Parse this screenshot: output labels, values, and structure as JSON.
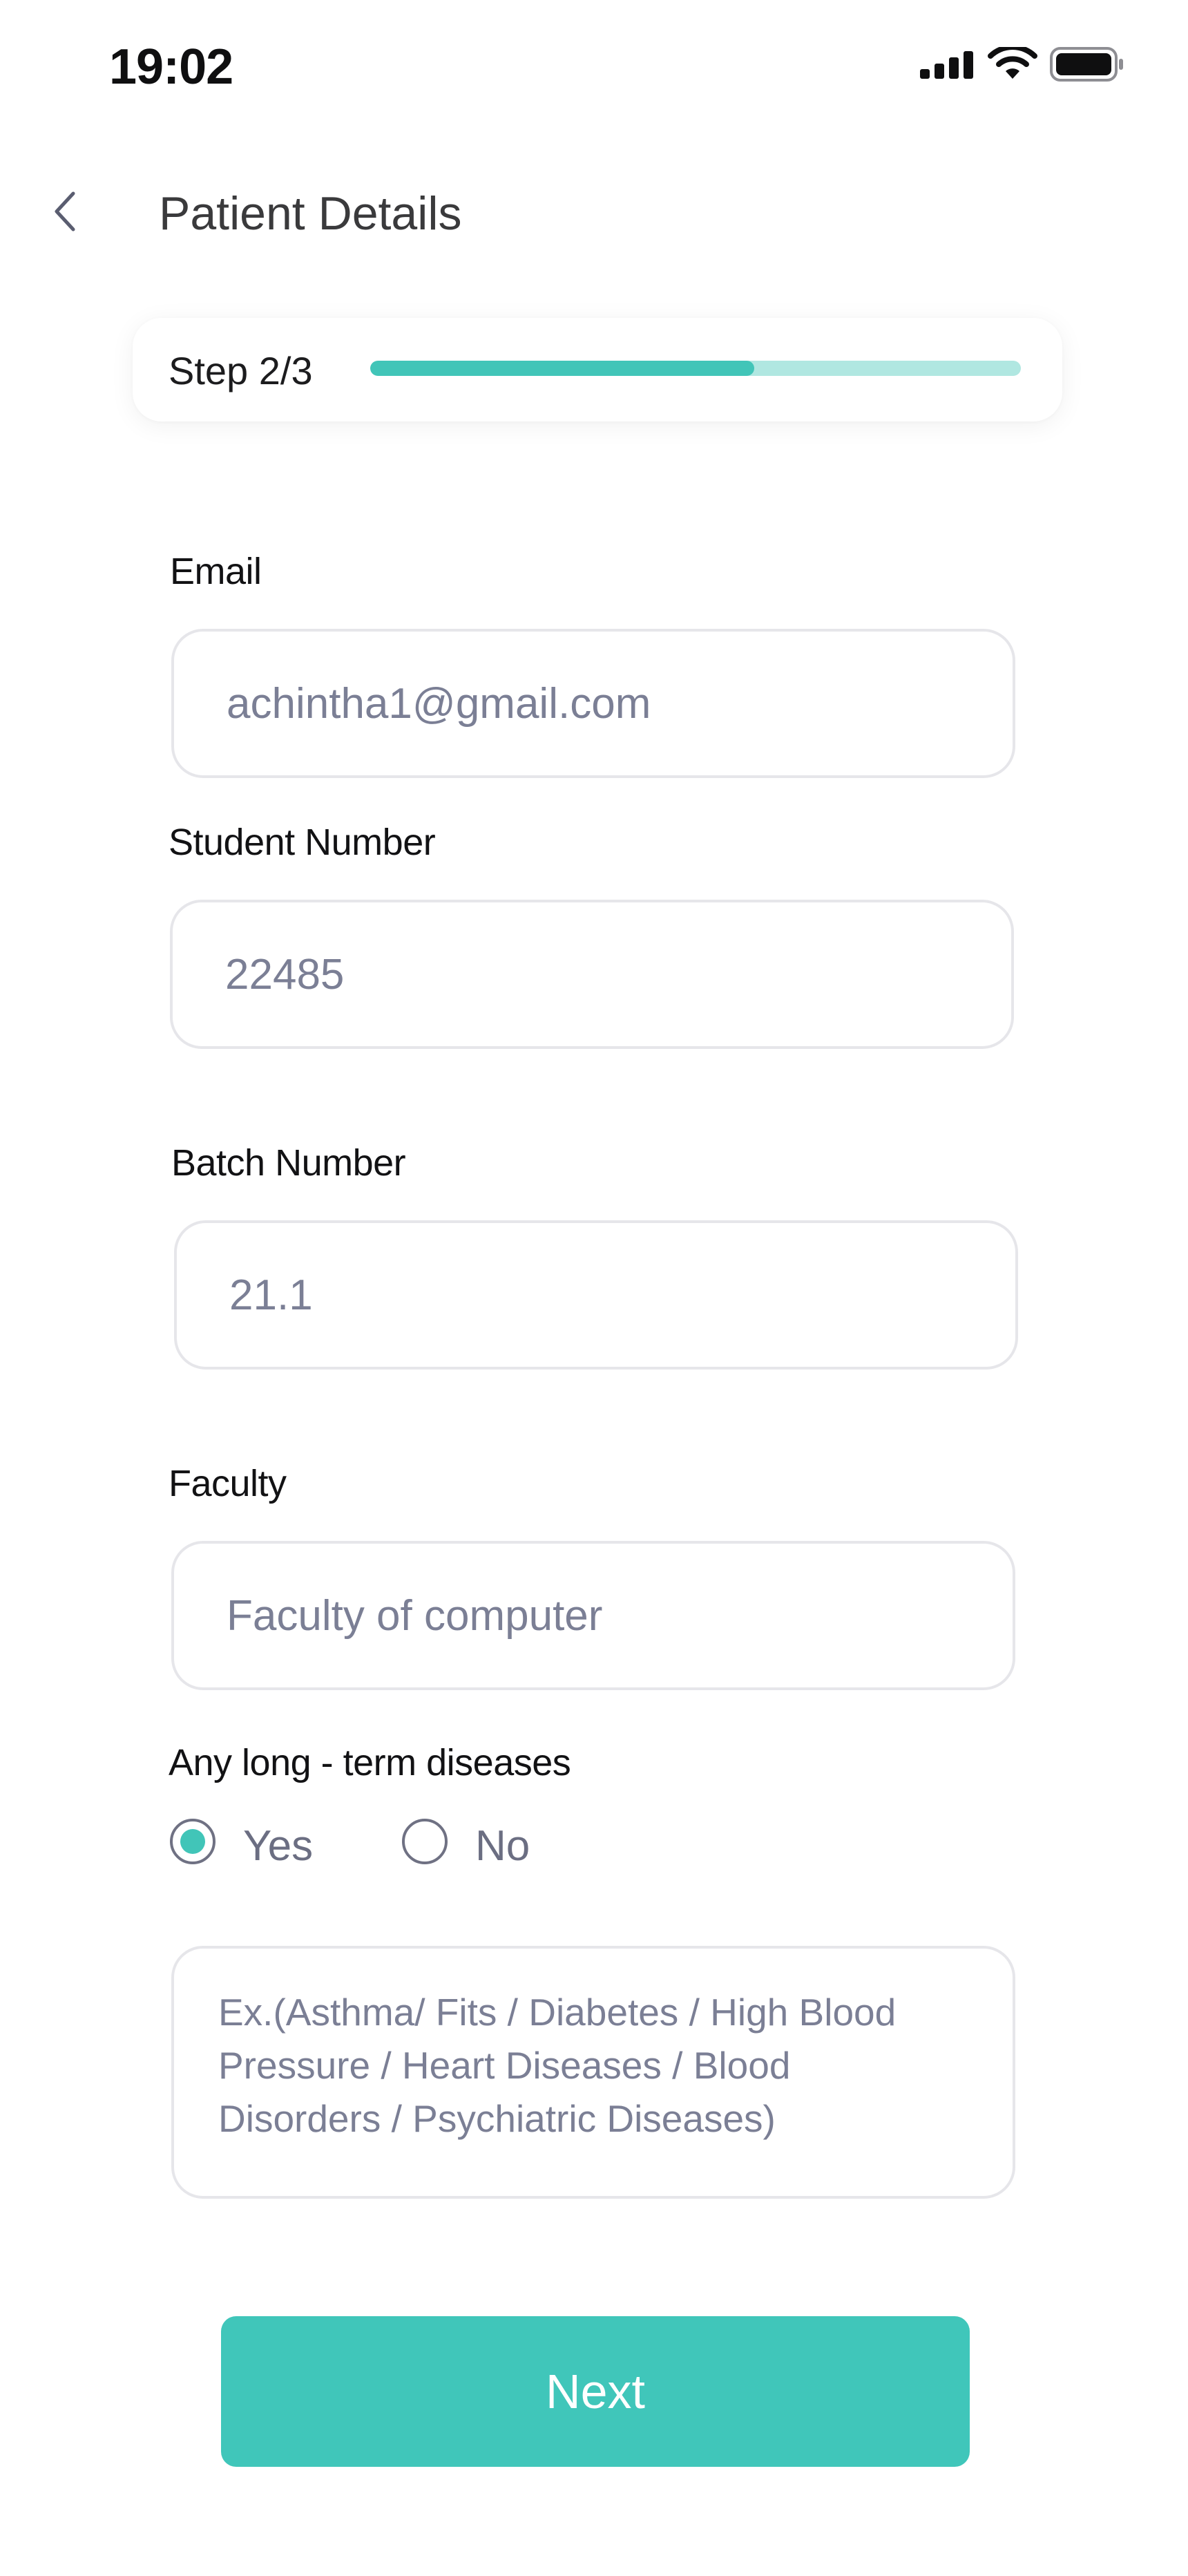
{
  "status_bar": {
    "time": "19:02",
    "icons": [
      "signal-icon",
      "wifi-icon",
      "battery-icon"
    ]
  },
  "header": {
    "back_icon": "chevron-left-icon",
    "title": "Patient Details"
  },
  "step": {
    "label": "Step 2/3",
    "progress": 0.59
  },
  "form": {
    "email": {
      "label": "Email",
      "value": "achintha1@gmail.com"
    },
    "student_number": {
      "label": "Student Number",
      "value": "22485"
    },
    "batch_number": {
      "label": "Batch Number",
      "value": "21.1"
    },
    "faculty": {
      "label": "Faculty",
      "value": "Faculty of computer"
    },
    "diseases": {
      "label": "Any long - term diseases",
      "options": [
        {
          "label": "Yes",
          "selected": true
        },
        {
          "label": "No",
          "selected": false
        }
      ],
      "placeholder": "Ex.(Asthma/ Fits / Diabetes / High Blood Pressure / Heart Diseases / Blood Disorders / Psychiatric Diseases)"
    }
  },
  "actions": {
    "next_label": "Next"
  },
  "colors": {
    "accent": "#41c5b8",
    "accent_light": "#b0e7e1",
    "text_muted": "#7b7f95",
    "border": "#e6e6ea"
  }
}
